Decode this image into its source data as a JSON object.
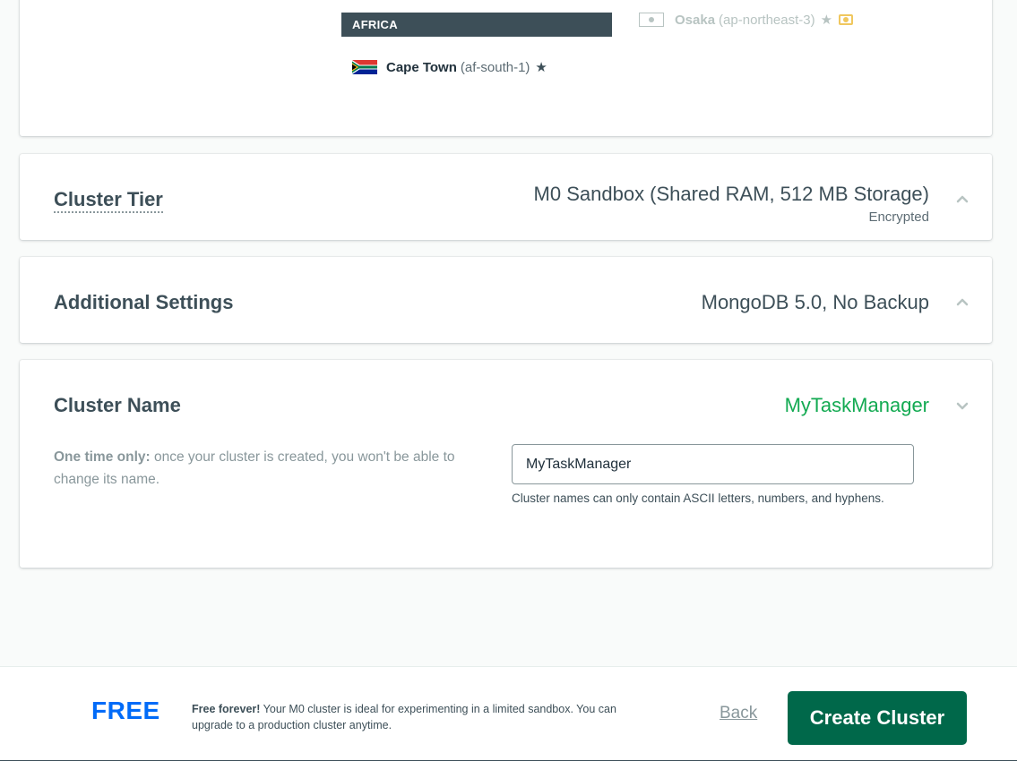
{
  "region": {
    "header": "AFRICA",
    "cape_town": {
      "name": "Cape Town",
      "code": "(af-south-1)"
    },
    "osaka": {
      "name": "Osaka",
      "code": "(ap-northeast-3)"
    }
  },
  "cluster_tier": {
    "title": "Cluster Tier",
    "value": "M0 Sandbox (Shared RAM, 512 MB Storage)",
    "sub_value": "Encrypted"
  },
  "additional_settings": {
    "title": "Additional Settings",
    "value": "MongoDB 5.0, No Backup"
  },
  "cluster_name": {
    "title": "Cluster Name",
    "value": "MyTaskManager",
    "note_bold": "One time only:",
    "note_text": " once your cluster is created, you won't be able to change its name.",
    "input_value": "MyTaskManager",
    "hint": "Cluster names can only contain ASCII letters, numbers, and hyphens."
  },
  "footer": {
    "price": "FREE",
    "text_bold": "Free forever!",
    "text": " Your M0 cluster is ideal for experimenting in a limited sandbox. You can upgrade to a production cluster anytime.",
    "back_label": "Back",
    "create_label": "Create Cluster"
  },
  "colors": {
    "accent_green": "#13aa52",
    "button_green": "#00684a",
    "free_blue": "#016bf8",
    "region_header_bg": "#3d4f58"
  },
  "icons": [
    "south-africa-flag-icon",
    "japan-flag-icon",
    "star-icon",
    "money-icon",
    "chevron-up-icon",
    "chevron-down-icon"
  ]
}
